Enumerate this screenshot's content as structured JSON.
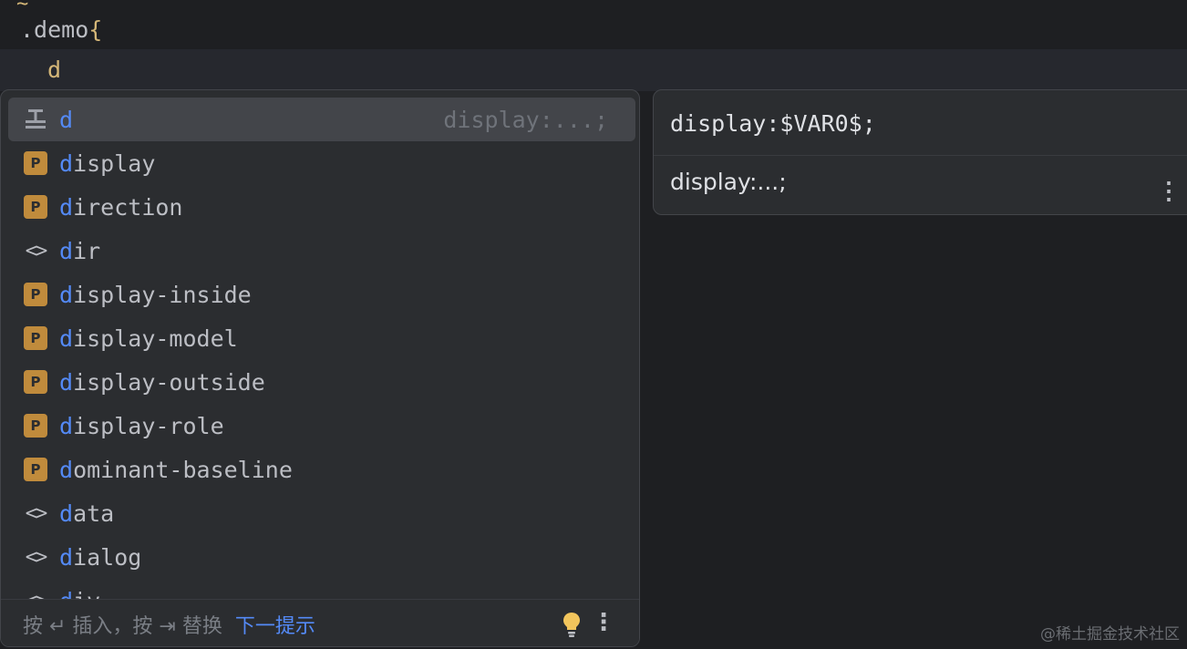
{
  "editor": {
    "tilde": "~",
    "line1_selector": ".demo",
    "line1_brace": "{",
    "line2_typed": "d"
  },
  "completion": {
    "items": [
      {
        "icon": "live-template-icon",
        "match": "d",
        "rest": "",
        "hint": "display:...;",
        "selected": true
      },
      {
        "icon": "property-icon",
        "badge": "P",
        "match": "d",
        "rest": "isplay"
      },
      {
        "icon": "property-icon",
        "badge": "P",
        "match": "d",
        "rest": "irection"
      },
      {
        "icon": "tag-icon",
        "glyph": "<>",
        "match": "d",
        "rest": "ir"
      },
      {
        "icon": "property-icon",
        "badge": "P",
        "match": "d",
        "rest": "isplay-inside"
      },
      {
        "icon": "property-icon",
        "badge": "P",
        "match": "d",
        "rest": "isplay-model"
      },
      {
        "icon": "property-icon",
        "badge": "P",
        "match": "d",
        "rest": "isplay-outside"
      },
      {
        "icon": "property-icon",
        "badge": "P",
        "match": "d",
        "rest": "isplay-role"
      },
      {
        "icon": "property-icon",
        "badge": "P",
        "match": "d",
        "rest": "ominant-baseline"
      },
      {
        "icon": "tag-icon",
        "glyph": "<>",
        "match": "d",
        "rest": "ata"
      },
      {
        "icon": "tag-icon",
        "glyph": "<>",
        "match": "d",
        "rest": "ialog"
      },
      {
        "icon": "tag-icon",
        "glyph": "<>",
        "match": "d",
        "rest": "iv"
      }
    ],
    "footer": {
      "hint": "按 ↵ 插入，按 ⇥ 替换",
      "next_hint": "下一提示"
    }
  },
  "doc_popup": {
    "code": "display:$VAR0$;",
    "text": "display:...;"
  },
  "watermark": "@稀土掘金技术社区",
  "colors": {
    "background": "#1e1f22",
    "popup": "#2b2d30",
    "match_highlight": "#548af7",
    "property_badge": "#c08b3c"
  }
}
